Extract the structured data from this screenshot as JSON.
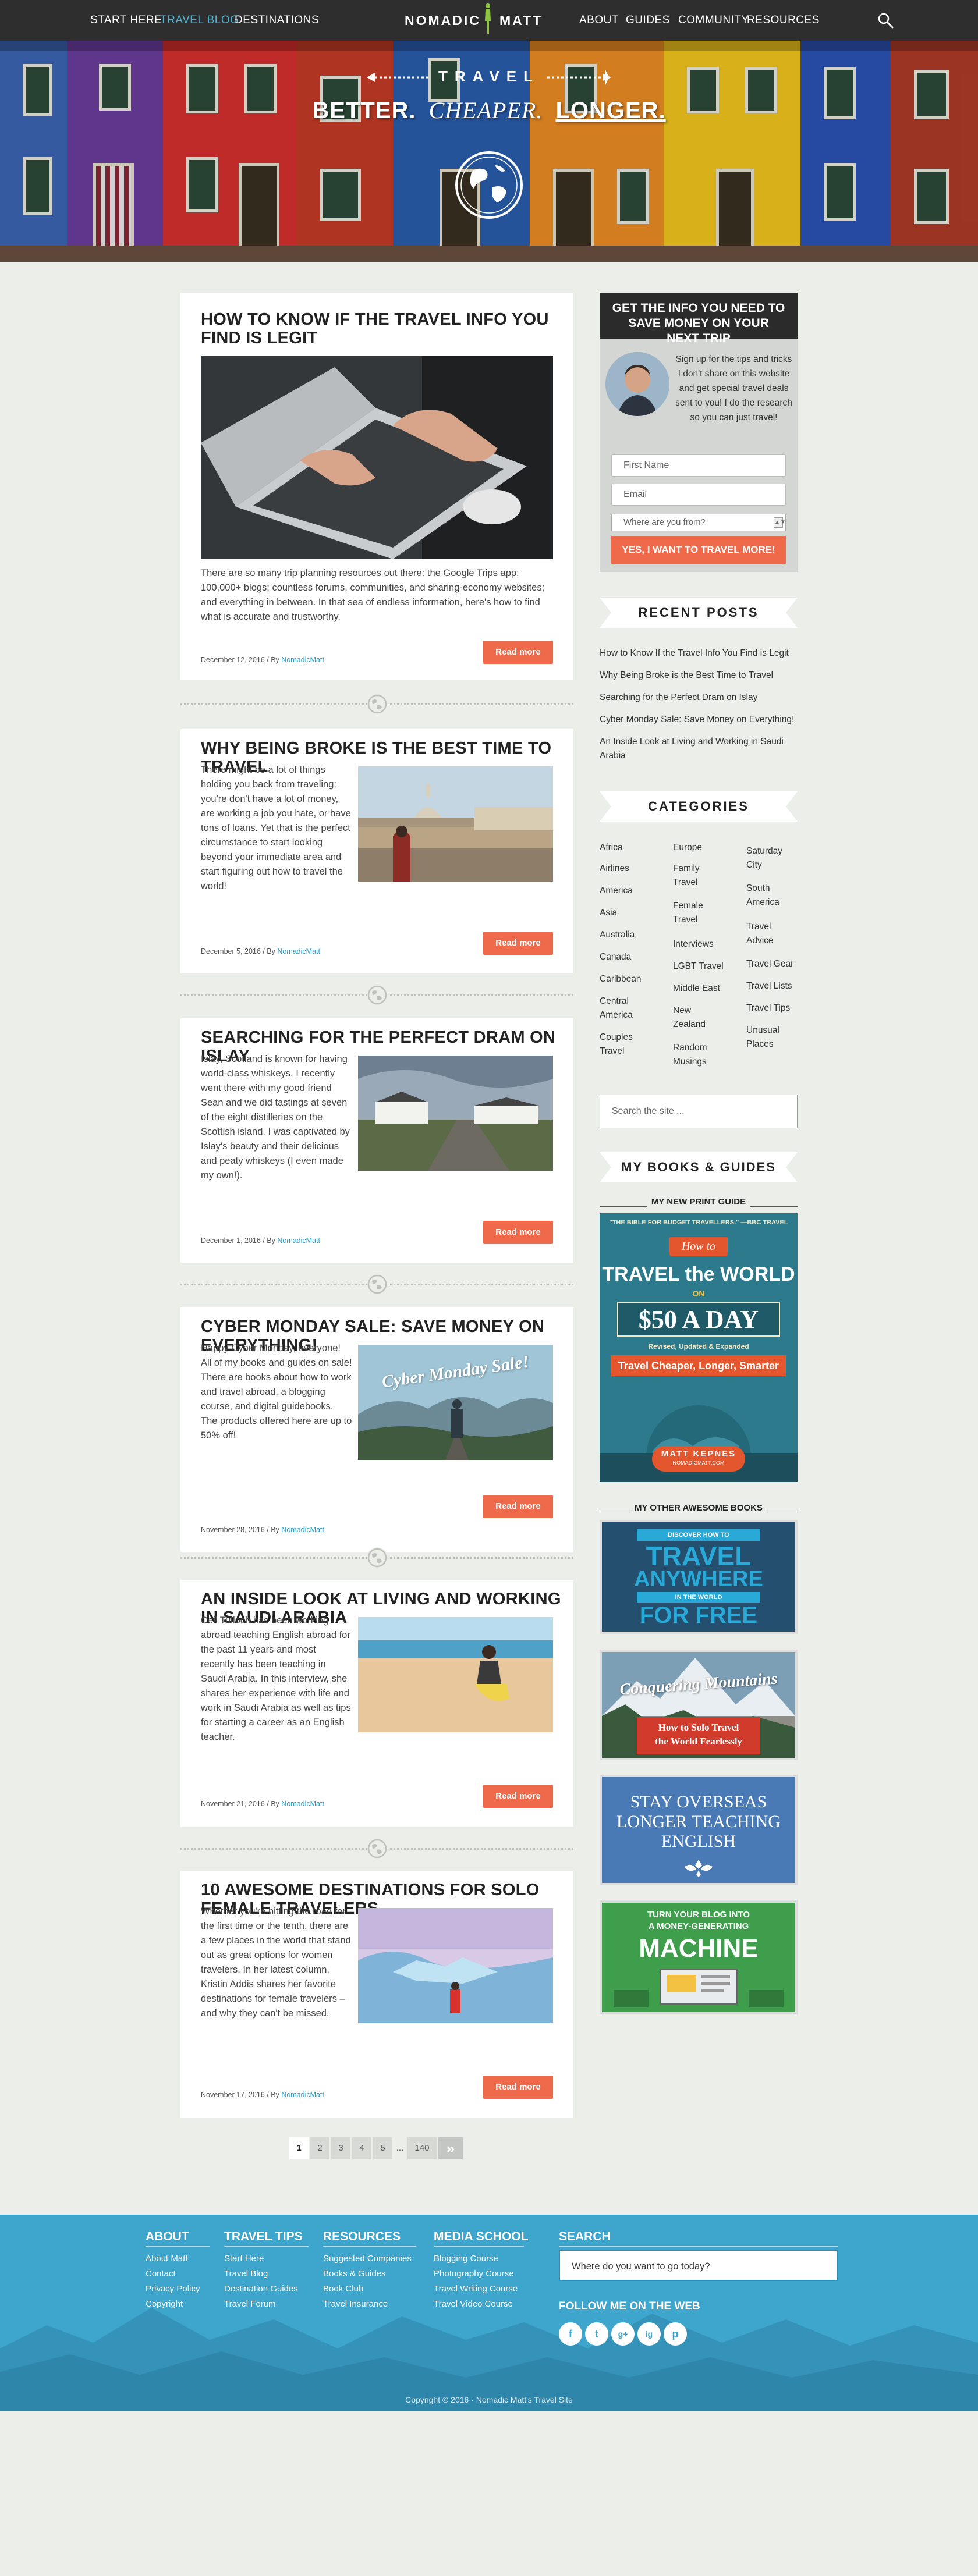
{
  "nav": {
    "left": [
      "Start Here",
      "Travel Blog",
      "Destinations"
    ],
    "active_index": 1,
    "right": [
      "About",
      "Guides",
      "Community",
      "Resources"
    ],
    "logo_left": "NOMADIC",
    "logo_right": "MATT",
    "search_icon": "search-icon"
  },
  "hero": {
    "travel": "TRAVEL",
    "tagline_1": "BETTER.",
    "tagline_2": "CHEAPER.",
    "tagline_3": "LONGER.",
    "globe_icon": "globe-icon"
  },
  "posts": [
    {
      "title": "HOW TO KNOW IF THE TRAVEL INFO YOU FIND IS LEGIT",
      "excerpt": "There are so many trip planning resources out there: the Google Trips app; 100,000+ blogs; countless forums, communities, and sharing-economy websites; and everything in between. In that sea of endless information, here's how to find what is accurate and trustworthy.",
      "date": "December 12, 2016",
      "by": "By",
      "author": "NomadicMatt",
      "read_more": "Read more"
    },
    {
      "title": "WHY BEING BROKE IS THE BEST TIME TO TRAVEL",
      "excerpt": "There might be a lot of things holding you back from traveling: you're don't have a lot of money, are working a job you hate, or have tons of loans. Yet that is the perfect circumstance to start looking beyond your immediate area and start figuring out how to travel the world!",
      "date": "December 5, 2016",
      "by": "By",
      "author": "NomadicMatt",
      "read_more": "Read more"
    },
    {
      "title": "SEARCHING FOR THE PERFECT DRAM ON ISLAY",
      "excerpt": "Islay, Scotland is known for having world-class whiskeys. I recently went there with my good friend Sean and we did tastings at seven of the eight distilleries on the Scottish island. I was captivated by Islay's beauty and their delicious and peaty whiskeys (I even made my own!).",
      "date": "December 1, 2016",
      "by": "By",
      "author": "NomadicMatt",
      "read_more": "Read more"
    },
    {
      "title": "CYBER MONDAY SALE: SAVE MONEY ON EVERYTHING!",
      "excerpt": "Happy Cyber Monday, everyone! All of my books and guides on sale! There are books about how to work and travel abroad, a blogging course, and digital guidebooks. The products offered here are up to 50% off!",
      "image_text": "Cyber Monday Sale!",
      "date": "November 28, 2016",
      "by": "By",
      "author": "NomadicMatt",
      "read_more": "Read more"
    },
    {
      "title": "AN INSIDE LOOK AT LIVING AND WORKING IN SAUDI ARABIA",
      "excerpt": "Ceil Tulloch has been working abroad teaching English abroad for the past 11 years and most recently has been teaching in Saudi Arabia. In this interview, she shares her experience with life and work in Saudi Arabia as well as tips for starting a career as an English teacher.",
      "date": "November 21, 2016",
      "by": "By",
      "author": "NomadicMatt",
      "read_more": "Read more"
    },
    {
      "title": "10 AWESOME DESTINATIONS FOR SOLO FEMALE TRAVELERS",
      "excerpt": "Whether you're hitting the road for the first time or the tenth, there are a few places in the world that stand out as great options for women travelers. In her latest column, Kristin Addis shares her favorite destinations for female travelers – and why they can't be missed.",
      "date": "November 17, 2016",
      "by": "By",
      "author": "NomadicMatt",
      "read_more": "Read more"
    }
  ],
  "optin": {
    "heading": "GET THE INFO YOU NEED TO SAVE MONEY ON YOUR NEXT TRIP",
    "text": "Sign up for the tips and tricks I don't share on this website and get special travel deals sent to you! I do the research so you can just travel!",
    "first_name_placeholder": "First Name",
    "email_placeholder": "Email",
    "country_select": "Where are you from?",
    "button": "YES, I WANT TO TRAVEL MORE!"
  },
  "recent_posts": {
    "heading": "RECENT POSTS",
    "items": [
      "How to Know If the Travel Info You Find is Legit",
      "Why Being Broke is the Best Time to Travel",
      "Searching for the Perfect Dram on Islay",
      "Cyber Monday Sale: Save Money on Everything!",
      "An Inside Look at Living and Working in Saudi Arabia"
    ]
  },
  "categories": {
    "heading": "CATEGORIES",
    "col1": [
      "Africa",
      "Airlines",
      "America",
      "Asia",
      "Australia",
      "Canada",
      "Caribbean",
      "Central America",
      "Couples Travel"
    ],
    "col2": [
      "Europe",
      "Family Travel",
      "Female Travel",
      "Interviews",
      "LGBT Travel",
      "Middle East",
      "New Zealand",
      "Random Musings"
    ],
    "col3": [
      "Saturday City",
      "South America",
      "Travel Advice",
      "Travel Gear",
      "Travel Lists",
      "Travel Tips",
      "Unusual Places"
    ]
  },
  "sidebar_search": {
    "placeholder": "Search the site ..."
  },
  "books": {
    "heading": "MY BOOKS & GUIDES",
    "new_label": "MY NEW PRINT GUIDE",
    "other_label": "MY OTHER AWESOME BOOKS",
    "book1": {
      "quote": "\"THE BIBLE FOR BUDGET TRAVELLERS.\" —BBC TRAVEL",
      "how_to": "How to",
      "title_a": "TRAVEL the WORLD",
      "on": "ON",
      "price": "$50 A DAY",
      "edition": "Revised, Updated & Expanded",
      "banner": "Travel Cheaper, Longer, Smarter",
      "author": "MATT KEPNES",
      "site": "NOMADICMATT.COM"
    },
    "book2": {
      "line1": "DISCOVER HOW TO",
      "line2": "TRAVEL",
      "line3": "ANYWHERE",
      "line4": "IN THE WORLD",
      "line5": "FOR FREE"
    },
    "book3": {
      "title": "Conquering Mountains",
      "sub1": "How to Solo Travel",
      "sub2": "the World Fearlessly"
    },
    "book4": {
      "line1": "STAY OVERSEAS",
      "line2": "LONGER TEACHING",
      "line3": "ENGLISH"
    },
    "book5": {
      "line1": "TURN YOUR BLOG INTO",
      "line2": "A MONEY-GENERATING",
      "line3": "MACHINE"
    }
  },
  "pagination": [
    "1",
    "2",
    "3",
    "4",
    "5",
    "...",
    "140",
    "»"
  ],
  "footer": {
    "cols": [
      {
        "title": "ABOUT",
        "links": [
          "About Matt",
          "Contact",
          "Privacy Policy",
          "Copyright"
        ]
      },
      {
        "title": "TRAVEL TIPS",
        "links": [
          "Start Here",
          "Travel Blog",
          "Destination Guides",
          "Travel Forum"
        ]
      },
      {
        "title": "RESOURCES",
        "links": [
          "Suggested Companies",
          "Books & Guides",
          "Book Club",
          "Travel Insurance"
        ]
      },
      {
        "title": "MEDIA SCHOOL",
        "links": [
          "Blogging Course",
          "Photography Course",
          "Travel Writing Course",
          "Travel Video Course"
        ]
      }
    ],
    "search_title": "SEARCH",
    "search_placeholder": "Where do you want to go today?",
    "follow_title": "FOLLOW ME ON THE WEB",
    "social": [
      "f",
      "t",
      "g+",
      "ig",
      "p"
    ],
    "copyright": "Copyright © 2016 · Nomadic Matt's Travel Site"
  },
  "colors": {
    "accent": "#ef6a4b",
    "link": "#2a9bc5",
    "footer": "#3ea5cc",
    "nav": "#2e2e2e"
  }
}
